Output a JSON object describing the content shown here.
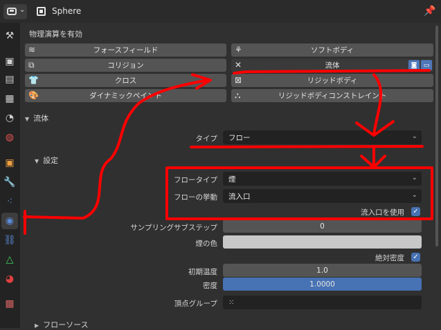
{
  "header": {
    "object_name": "Sphere",
    "editor_icon": "properties-editor-icon",
    "object_icon": "object-data-icon",
    "pin_icon": "pin-icon"
  },
  "tabs": [
    {
      "name": "tool-tab",
      "glyph": "⚒"
    },
    {
      "name": "render-tab",
      "glyph": "📷"
    },
    {
      "name": "output-tab",
      "glyph": "🖨"
    },
    {
      "name": "view-layer-tab",
      "glyph": "▦"
    },
    {
      "name": "scene-tab",
      "glyph": "◔"
    },
    {
      "name": "world-tab",
      "glyph": "◍"
    },
    {
      "name": "object-tab",
      "glyph": "▣"
    },
    {
      "name": "modifiers-tab",
      "glyph": "🔧"
    },
    {
      "name": "particles-tab",
      "glyph": "⁖"
    },
    {
      "name": "physics-tab",
      "glyph": "◉"
    },
    {
      "name": "constraints-tab",
      "glyph": "⛓"
    },
    {
      "name": "data-tab",
      "glyph": "△"
    },
    {
      "name": "material-tab",
      "glyph": "◕"
    },
    {
      "name": "texture-tab",
      "glyph": "▩"
    }
  ],
  "physics": {
    "enable_label": "物理演算を有効",
    "buttons": {
      "force_field": "フォースフィールド",
      "soft_body": "ソフトボディ",
      "collision": "コリジョン",
      "fluid": "流体",
      "cloth": "クロス",
      "rigid_body": "リジッドボディ",
      "dynamic_paint": "ダイナミックペイント",
      "rigid_body_constraint": "リジッドボディコンストレイント"
    }
  },
  "fluid_panel": {
    "title": "流体",
    "type_label": "タイプ",
    "type_value": "フロー",
    "settings": {
      "title": "設定",
      "flow_type_label": "フロータイプ",
      "flow_type_value": "煙",
      "flow_behavior_label": "フローの挙動",
      "flow_behavior_value": "流入口",
      "use_inflow_label": "流入口を使用",
      "use_inflow": true,
      "substeps_label": "サンプリングサブステップ",
      "substeps_value": "0",
      "smoke_color_label": "煙の色",
      "smoke_color": "#c8c8c8",
      "absolute_density_label": "絶対密度",
      "absolute_density": true,
      "initial_temp_label": "初期温度",
      "initial_temp_value": "1.0",
      "density_label": "密度",
      "density_value": "1.0000",
      "vertex_group_label": "頂点グループ",
      "vertex_group_value": ""
    },
    "flow_source_title": "フローソース"
  },
  "colors": {
    "accent": "#4772b3",
    "annotation": "#ff0000"
  }
}
